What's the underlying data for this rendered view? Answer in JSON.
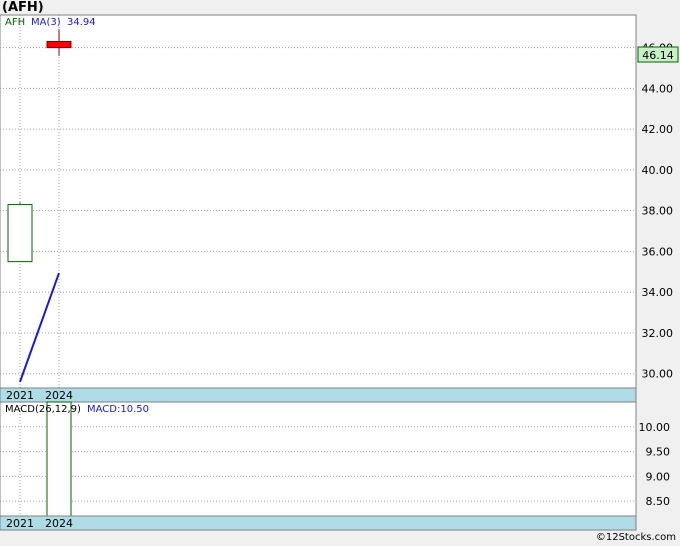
{
  "header": {
    "title": "(AFH)"
  },
  "footer": {
    "copyright": "©12Stocks.com"
  },
  "colors": {
    "up_candle": "#006400",
    "down_candle": "#ff0000",
    "ma_line": "#1a1acd",
    "axis_band": "#b0dce8",
    "price_label_bg": "#c8f0c8",
    "legend_symbol": "#006400",
    "legend_indicator": "#1a1acd"
  },
  "chart_data": [
    {
      "type": "candlestick",
      "legend": {
        "symbol": "AFH",
        "ma_label": "MA(3)",
        "ma_value": "34.94"
      },
      "x_labels": [
        "2021",
        "2024"
      ],
      "ylim": [
        29.3,
        47.6
      ],
      "y_ticks": [
        "30.00",
        "32.00",
        "34.00",
        "36.00",
        "38.00",
        "40.00",
        "42.00",
        "44.00",
        "46.00"
      ],
      "last_price": "46.14",
      "candles": [
        {
          "x": "2021",
          "open": 35.5,
          "high": 38.4,
          "low": 35.5,
          "close": 38.3
        },
        {
          "x": "2024",
          "open": 46.3,
          "high": 46.9,
          "low": 45.6,
          "close": 46.0
        }
      ],
      "ma_series": [
        {
          "x": "2021",
          "value": 29.6
        },
        {
          "x": "2024",
          "value": 34.94
        }
      ],
      "grid": true
    },
    {
      "type": "bar",
      "legend": {
        "label": "MACD(26,12,9)",
        "value_label": "MACD:10.50"
      },
      "x_labels": [
        "2021",
        "2024"
      ],
      "ylim": [
        8.2,
        10.5
      ],
      "y_ticks": [
        "8.50",
        "9.00",
        "9.50",
        "10.00"
      ],
      "bars": [
        {
          "x": "2024",
          "value": 10.5
        }
      ],
      "grid": true
    }
  ]
}
